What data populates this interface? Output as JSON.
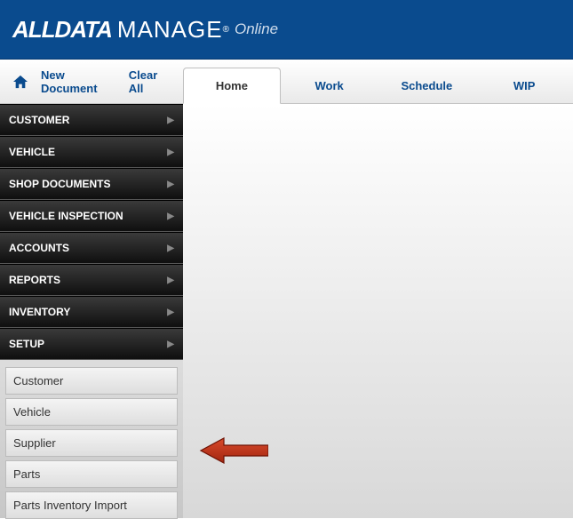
{
  "brand": {
    "part1": "ALL",
    "part2": "DATA",
    "part3": "MANAGE",
    "part4": "Online"
  },
  "toolbar": {
    "new_document": "New Document",
    "clear_all": "Clear All"
  },
  "tabs": {
    "home": "Home",
    "work": "Work",
    "schedule": "Schedule",
    "wip": "WIP"
  },
  "nav": {
    "customer": "CUSTOMER",
    "vehicle": "VEHICLE",
    "shop_documents": "SHOP DOCUMENTS",
    "vehicle_inspection": "VEHICLE INSPECTION",
    "accounts": "ACCOUNTS",
    "reports": "REPORTS",
    "inventory": "INVENTORY",
    "setup": "SETUP"
  },
  "setup_sub": {
    "customer": "Customer",
    "vehicle": "Vehicle",
    "supplier": "Supplier",
    "parts": "Parts",
    "parts_inventory_import": "Parts Inventory Import"
  }
}
